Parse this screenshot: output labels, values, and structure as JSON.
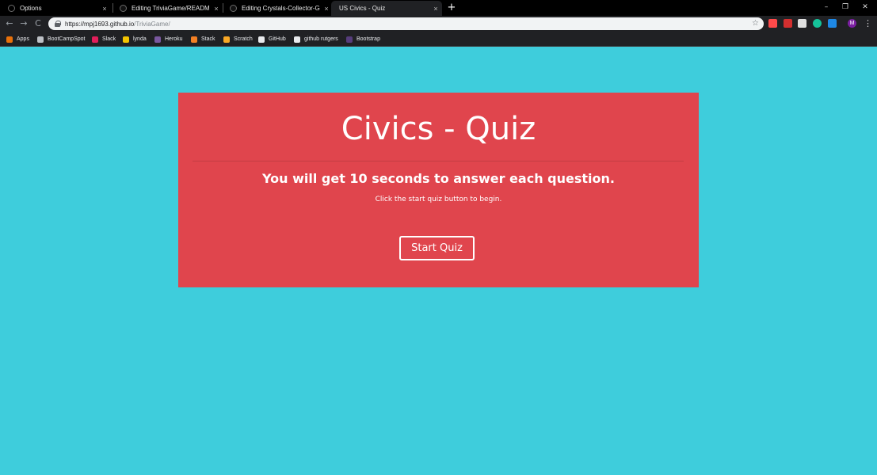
{
  "browser": {
    "tabs": [
      {
        "title": "Options",
        "active": false
      },
      {
        "title": "Editing TriviaGame/README.md",
        "active": false
      },
      {
        "title": "Editing Crystals-Collector-Game/",
        "active": false
      },
      {
        "title": "US Civics - Quiz",
        "active": true
      }
    ],
    "tab_close_glyph": "×",
    "new_tab_glyph": "+",
    "window_controls": {
      "minimize": "–",
      "restore": "❐",
      "close": "✕"
    },
    "nav": {
      "back": "←",
      "forward": "→",
      "reload": "C"
    },
    "address": {
      "host": "https://mpj1693.github.io",
      "path": "/TriviaGame/"
    },
    "bookmark_star": "☆",
    "menu_glyph": "⋮",
    "profile_initial": "M",
    "bookmarks": [
      {
        "label": "Apps",
        "icon": "apps-grid-icon",
        "color": "#e8710a"
      },
      {
        "label": "BootCampSpot",
        "icon": "page-icon",
        "color": "#bdc1c6"
      },
      {
        "label": "Slack",
        "icon": "slack-icon",
        "color": "#e01e5a"
      },
      {
        "label": "lynda",
        "icon": "lynda-icon",
        "color": "#f3c400"
      },
      {
        "label": "Heroku",
        "icon": "heroku-icon",
        "color": "#79589f"
      },
      {
        "label": "Stack",
        "icon": "stack-overflow-icon",
        "color": "#f48024"
      },
      {
        "label": "Scratch",
        "icon": "scratch-icon",
        "color": "#f9a825"
      },
      {
        "label": "GitHub",
        "icon": "github-icon",
        "color": "#e8eaed"
      },
      {
        "label": "github rutgers",
        "icon": "github-icon",
        "color": "#e8eaed"
      },
      {
        "label": "Bootstrap",
        "icon": "bootstrap-icon",
        "color": "#563d7c"
      }
    ],
    "extension_colors": [
      "#ff4a4a",
      "#d32f2f",
      "#e0e0e0",
      "#15c39a",
      "#1e88e5"
    ]
  },
  "page": {
    "title": "Civics - Quiz",
    "subtitle": "You will get 10 seconds to answer each question.",
    "hint": "Click the start quiz button to begin.",
    "start_button": "Start Quiz",
    "background_color": "#3ecddc",
    "card_color": "#e0454d"
  }
}
